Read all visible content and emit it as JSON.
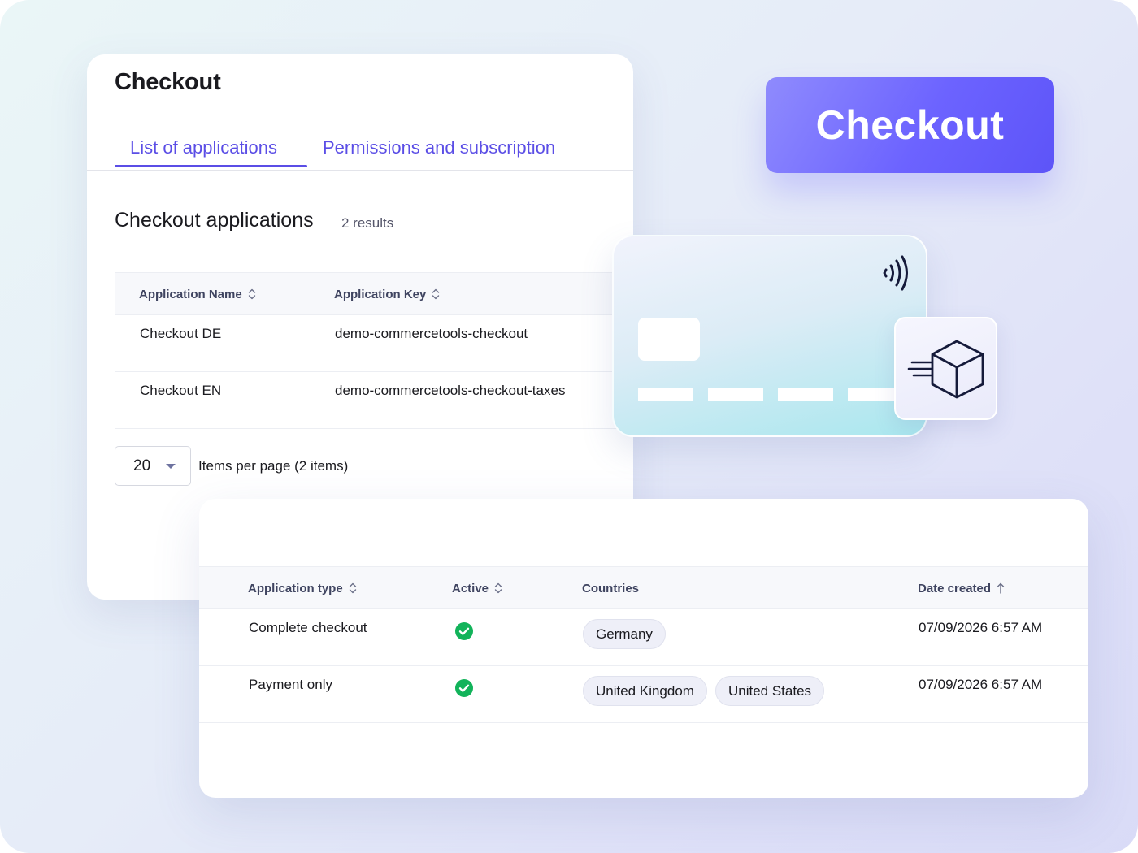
{
  "back_panel": {
    "title": "Checkout",
    "tabs": [
      {
        "label": "List of applications",
        "active": true
      },
      {
        "label": "Permissions and subscription",
        "active": false
      }
    ],
    "section_title": "Checkout applications",
    "result_count": "2 results",
    "table": {
      "columns": [
        "Application Name",
        "Application Key"
      ],
      "rows": [
        {
          "name": "Checkout DE",
          "key": "demo-commercetools-checkout"
        },
        {
          "name": "Checkout EN",
          "key": "demo-commercetools-checkout-taxes"
        }
      ]
    },
    "pagination": {
      "per_page": "20",
      "label": "Items per page (2 items)"
    }
  },
  "brand_badge": {
    "text": "Checkout",
    "colors": {
      "start": "#8f8bfd",
      "end": "#5d54f8"
    }
  },
  "illustration": {
    "card_icon": "contactless-icon",
    "tile_icon": "fast-delivery-box-icon"
  },
  "front_panel": {
    "table": {
      "columns": [
        "Application type",
        "Active",
        "Countries",
        "Date created"
      ],
      "rows": [
        {
          "type": "Complete checkout",
          "active": true,
          "countries": [
            "Germany"
          ],
          "date": "07/09/2026 6:57 AM"
        },
        {
          "type": "Payment only",
          "active": true,
          "countries": [
            "United Kingdom",
            "United States"
          ],
          "date": "07/09/2026 6:57 AM"
        }
      ]
    }
  },
  "colors": {
    "accent": "#5b4ee6",
    "success": "#12b35a",
    "text": "#1a1a1f"
  }
}
